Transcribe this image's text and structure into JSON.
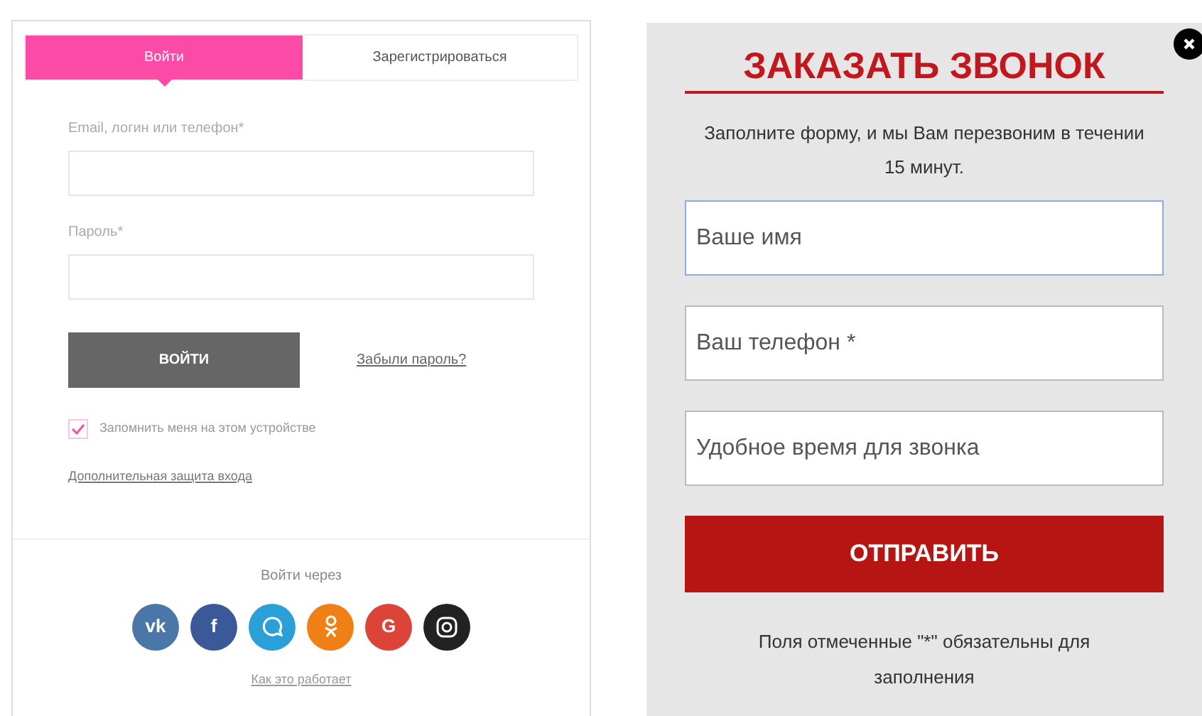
{
  "login": {
    "tabs": [
      {
        "label": "Войти",
        "selected": true
      },
      {
        "label": "Зарегистрироваться",
        "selected": false
      }
    ],
    "fields": [
      {
        "label": "Email, логин или телефон*"
      },
      {
        "label": "Пароль*"
      }
    ],
    "submit": "ВОЙТИ",
    "forgot": "Забыли пароль?",
    "remember": {
      "label": "Запомнить меня на этом устройстве",
      "checked": true
    },
    "extra_link": "Дополнительная защита входа",
    "social_title": "Войти через",
    "social": [
      {
        "kind": "text",
        "label": "vk",
        "color": "#4a76a8"
      },
      {
        "kind": "text",
        "label": "f",
        "color": "#3b5998"
      },
      {
        "kind": "message",
        "color": "#2a9fd8"
      },
      {
        "kind": "person",
        "color": "#f07f16"
      },
      {
        "kind": "text",
        "label": "G",
        "color": "#db4437"
      },
      {
        "kind": "camera",
        "color": "#222222"
      }
    ],
    "how": "Как это работает"
  },
  "callback": {
    "title": "ЗАКАЗАТЬ ЗВОНОК",
    "subtitle": "Заполните форму, и мы Вам перезвоним в течении 15 минут.",
    "fields": [
      {
        "placeholder": "Ваше имя",
        "focused": true
      },
      {
        "placeholder": "Ваш телефон *",
        "focused": false
      },
      {
        "placeholder": "Удобное время для звонка",
        "focused": false
      }
    ],
    "submit": "ОТПРАВИТЬ",
    "note": "Поля отмеченные \"*\" обязательны для заполнения"
  }
}
